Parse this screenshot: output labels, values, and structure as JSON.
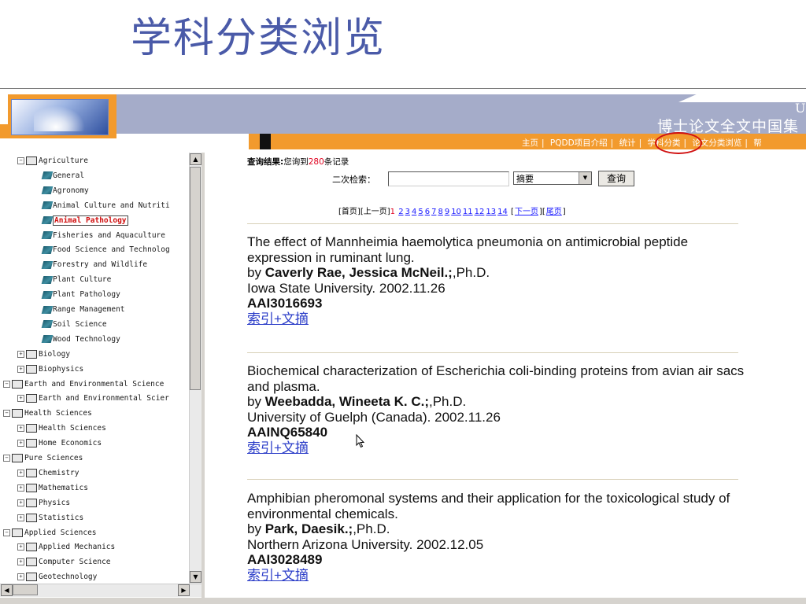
{
  "slide_title": "学科分类浏览",
  "banner": {
    "edge_letter": "U",
    "title": "博士论文全文中国集",
    "nav": [
      "主页",
      "PQDD项目介绍",
      "统计",
      "学科分类",
      "论文分类浏览",
      "帮"
    ]
  },
  "tree": {
    "items": [
      {
        "label": "Agriculture",
        "level": 1,
        "kind": "folder-open",
        "expand": "−"
      },
      {
        "label": "General",
        "level": 2,
        "kind": "book"
      },
      {
        "label": "Agronomy",
        "level": 2,
        "kind": "book"
      },
      {
        "label": "Animal Culture and Nutriti",
        "level": 2,
        "kind": "book"
      },
      {
        "label": "Animal Pathology",
        "level": 2,
        "kind": "book",
        "selected": true
      },
      {
        "label": "Fisheries and Aquaculture",
        "level": 2,
        "kind": "book"
      },
      {
        "label": "Food Science and Technolog",
        "level": 2,
        "kind": "book"
      },
      {
        "label": "Forestry and Wildlife",
        "level": 2,
        "kind": "book"
      },
      {
        "label": "Plant Culture",
        "level": 2,
        "kind": "book"
      },
      {
        "label": "Plant Pathology",
        "level": 2,
        "kind": "book"
      },
      {
        "label": "Range Management",
        "level": 2,
        "kind": "book"
      },
      {
        "label": "Soil Science",
        "level": 2,
        "kind": "book"
      },
      {
        "label": "Wood Technology",
        "level": 2,
        "kind": "book"
      },
      {
        "label": "Biology",
        "level": 1,
        "kind": "folder",
        "expand": "+"
      },
      {
        "label": "Biophysics",
        "level": 1,
        "kind": "folder",
        "expand": "+"
      },
      {
        "label": "Earth and Environmental Science",
        "level": 0,
        "kind": "folder-open",
        "expand": "−"
      },
      {
        "label": "Earth and Environmental Scier",
        "level": 1,
        "kind": "folder",
        "expand": "+"
      },
      {
        "label": "Health Sciences",
        "level": 0,
        "kind": "folder-open",
        "expand": "−"
      },
      {
        "label": "Health Sciences",
        "level": 1,
        "kind": "folder",
        "expand": "+"
      },
      {
        "label": "Home Economics",
        "level": 1,
        "kind": "folder",
        "expand": "+"
      },
      {
        "label": "Pure Sciences",
        "level": 0,
        "kind": "folder-open",
        "expand": "−"
      },
      {
        "label": "Chemistry",
        "level": 1,
        "kind": "folder",
        "expand": "+"
      },
      {
        "label": "Mathematics",
        "level": 1,
        "kind": "folder",
        "expand": "+"
      },
      {
        "label": "Physics",
        "level": 1,
        "kind": "folder",
        "expand": "+"
      },
      {
        "label": "Statistics",
        "level": 1,
        "kind": "folder",
        "expand": "+"
      },
      {
        "label": "Applied Sciences",
        "level": 0,
        "kind": "folder-open",
        "expand": "−"
      },
      {
        "label": "Applied Mechanics",
        "level": 1,
        "kind": "folder",
        "expand": "+"
      },
      {
        "label": "Computer Science",
        "level": 1,
        "kind": "folder",
        "expand": "+"
      },
      {
        "label": "Geotechnology",
        "level": 1,
        "kind": "folder",
        "expand": "+"
      }
    ]
  },
  "results": {
    "label": "查询结果:",
    "prefix": "您询到",
    "count": "280",
    "suffix": "条记录"
  },
  "search": {
    "label": "二次检索：",
    "input_value": "",
    "select_value": "摘要",
    "button": "查询"
  },
  "pager": {
    "first": "[首页]",
    "prev": "[上一页]",
    "current": "1",
    "pages": [
      "2",
      "3",
      "4",
      "5",
      "6",
      "7",
      "8",
      "9",
      "10",
      "11",
      "12",
      "13",
      "14"
    ],
    "next": "下一页",
    "last": "尾页"
  },
  "records": [
    {
      "title": "The effect of Mannheimia haemolytica pneumonia on antimicrobial peptide expression in ruminant lung.",
      "by_prefix": "by ",
      "authors": "Caverly Rae, Jessica McNeil.;",
      "degree": ",Ph.D.",
      "univ_date": "Iowa State University. 2002.11.26",
      "id": "AAI3016693",
      "link": "索引+文摘"
    },
    {
      "title": "Biochemical characterization of Escherichia coli-binding proteins from avian air sacs and plasma.",
      "by_prefix": "by ",
      "authors": "Weebadda, Wineeta K. C.;",
      "degree": ",Ph.D.",
      "univ_date": "University of Guelph (Canada). 2002.11.26",
      "id": "AAINQ65840",
      "link": "索引+文摘"
    },
    {
      "title": "Amphibian pheromonal systems and their application for the toxicological study of environmental chemicals.",
      "by_prefix": "by ",
      "authors": "Park, Daesik.;",
      "degree": ",Ph.D.",
      "univ_date": "Northern Arizona University. 2002.12.05",
      "id": "AAI3028489",
      "link": "索引+文摘"
    }
  ],
  "colors": {
    "banner": "#a5acc9",
    "orange": "#f29a2d",
    "highlight": "#d01010",
    "link": "#2a3cc8",
    "count": "#e0001e"
  }
}
